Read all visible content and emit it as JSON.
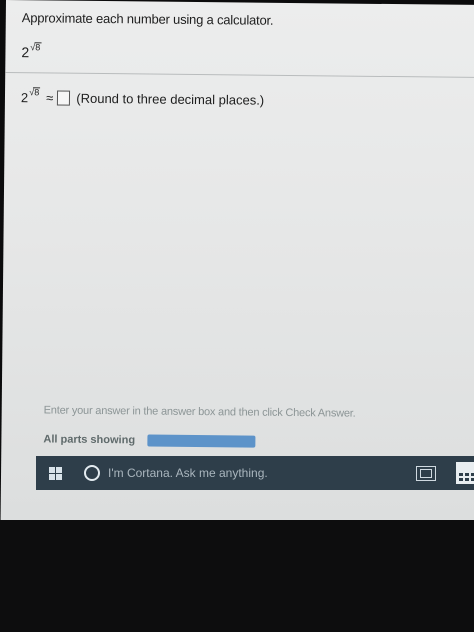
{
  "question": {
    "instruction": "Approximate each number using a calculator.",
    "expression_base": "2",
    "expression_exponent": "8",
    "approx_symbol": "≈",
    "rounding_note": "(Round to three decimal places.)"
  },
  "footer": {
    "hint": "Enter your answer in the answer box and then click Check Answer.",
    "status_label": "All parts showing"
  },
  "taskbar": {
    "cortana_placeholder": "I'm Cortana. Ask me anything."
  }
}
